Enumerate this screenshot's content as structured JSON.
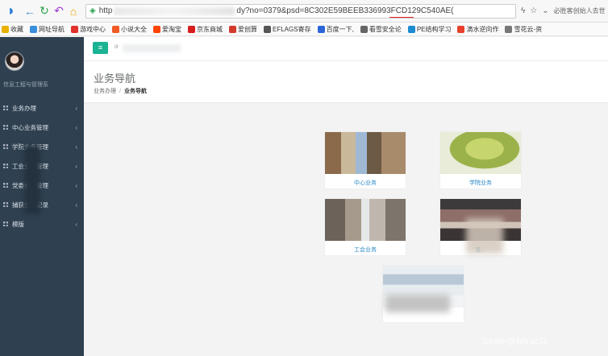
{
  "browser": {
    "url_prefix": "http",
    "url_fragment_dy": "dy?no=",
    "url_highlight": "0379",
    "url_suffix": "&psd=8C302E59BEEB336993FCD129C540AE(",
    "right_text": "必胜客创始人去世",
    "bookmarks": [
      {
        "label": "收藏",
        "icon": "star-icon",
        "color": "#e8b100"
      },
      {
        "label": "网址导航",
        "icon": "globe-icon",
        "color": "#3a8edb"
      },
      {
        "label": "游戏中心",
        "icon": "game-icon",
        "color": "#e0312a"
      },
      {
        "label": "小说大全",
        "icon": "book-icon",
        "color": "#f05a24"
      },
      {
        "label": "爱淘宝",
        "icon": "taobao-icon",
        "color": "#ff4400"
      },
      {
        "label": "京东商城",
        "icon": "jd-icon",
        "color": "#d71c1c"
      },
      {
        "label": "爱创算",
        "icon": "calc-icon",
        "color": "#d23a2c"
      },
      {
        "label": "EFLAGS寄存",
        "icon": "doc-icon",
        "color": "#555555"
      },
      {
        "label": "百度一下,",
        "icon": "baidu-icon",
        "color": "#2a66d8"
      },
      {
        "label": "看雪安全论",
        "icon": "snow-icon",
        "color": "#666666"
      },
      {
        "label": "PE结构学习",
        "icon": "pe-icon",
        "color": "#1a8ccf"
      },
      {
        "label": "滴水逆向作",
        "icon": "drop-icon",
        "color": "#e8402a"
      },
      {
        "label": "雪花云-资",
        "icon": "cloud-icon",
        "color": "#777777"
      }
    ]
  },
  "sidebar": {
    "dept": "信息工程与管理系",
    "items": [
      {
        "label": "业务办理"
      },
      {
        "label": "中心业务管理"
      },
      {
        "label": "学院业务管理"
      },
      {
        "label": "工会业务管理"
      },
      {
        "label": "党委业务管理"
      },
      {
        "label": "捕获业务记录"
      },
      {
        "label": "模版"
      }
    ]
  },
  "topbar": {
    "menu_icon": "≡",
    "text": "ifr"
  },
  "page": {
    "title": "业务导航",
    "crumbs": [
      "业务办理",
      "业务导航"
    ]
  },
  "cards": [
    {
      "label": "中心业务"
    },
    {
      "label": "学院业务"
    },
    {
      "label": "工会业务"
    },
    {
      "label": "党..."
    },
    {
      "label": ""
    }
  ],
  "watermark": "Sedin@Miracl3"
}
